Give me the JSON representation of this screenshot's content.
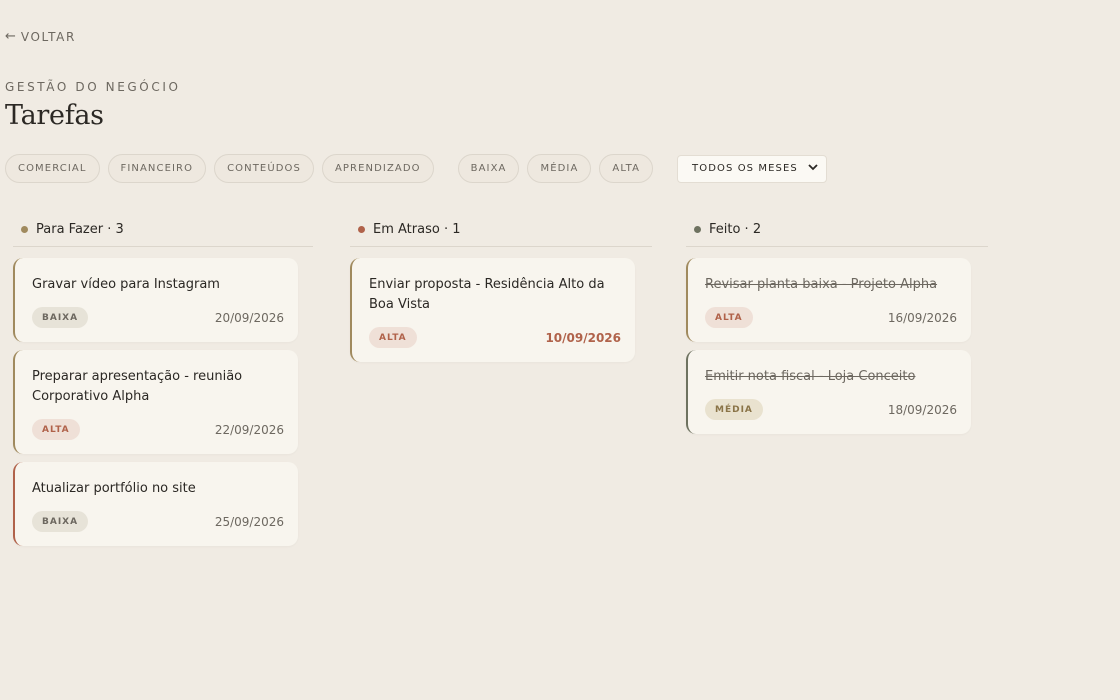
{
  "nav": {
    "back_arrow": "←",
    "back_label": "VOLTAR"
  },
  "header": {
    "eyebrow": "GESTÃO DO NEGÓCIO",
    "title": "Tarefas"
  },
  "filters": {
    "categories": [
      "COMERCIAL",
      "FINANCEIRO",
      "CONTEÚDOS",
      "APRENDIZADO"
    ],
    "priorities": [
      "BAIXA",
      "MÉDIA",
      "ALTA"
    ],
    "month_select": {
      "value": "TODOS OS MESES"
    }
  },
  "columns": [
    {
      "title": "Para Fazer · 3",
      "dot_color": "#a08a5e",
      "cards": [
        {
          "title": "Gravar vídeo para Instagram",
          "priority": "BAIXA",
          "date": "20/09/2026"
        },
        {
          "title": "Preparar apresentação - reunião Corporativo Alpha",
          "priority": "ALTA",
          "date": "22/09/2026"
        },
        {
          "title": "Atualizar portfólio no site",
          "priority": "BAIXA",
          "date": "25/09/2026"
        }
      ]
    },
    {
      "title": "Em Atraso · 1",
      "dot_color": "#b0624a",
      "cards": [
        {
          "title": "Enviar proposta - Residência Alto da Boa Vista",
          "priority": "ALTA",
          "date": "10/09/2026"
        }
      ]
    },
    {
      "title": "Feito · 2",
      "dot_color": "#6e7260",
      "cards": [
        {
          "title": "Revisar planta baixa - Projeto Alpha",
          "priority": "ALTA",
          "date": "16/09/2026"
        },
        {
          "title": "Emitir nota fiscal - Loja Conceito",
          "priority": "MÉDIA",
          "date": "18/09/2026"
        }
      ]
    }
  ],
  "colors": {
    "background": "#f0ebe3",
    "card_background": "#f8f5ee",
    "overdue_accent": "#b0624a",
    "done_accent": "#6e7260"
  }
}
